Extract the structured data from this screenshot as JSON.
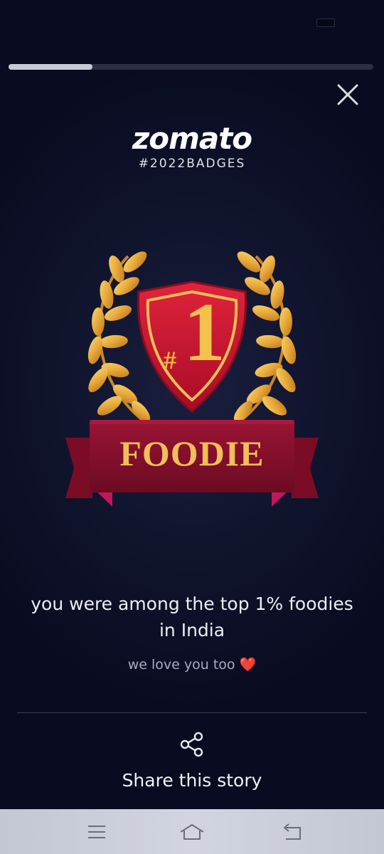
{
  "story": {
    "progress": 0.23,
    "brand": "zomato",
    "tag": "#2022BADGES",
    "badge": {
      "hash": "#",
      "number": "1",
      "ribbon_text": "FOODIE"
    },
    "headline": "you were among the top 1% foodies in India",
    "subline": "we love you too",
    "heart": "❤️",
    "share_label": "Share this story"
  },
  "icons": {
    "close": "close-icon",
    "share": "share-icon",
    "menu": "menu-icon",
    "home": "home-icon",
    "back": "back-icon"
  },
  "colors": {
    "background": "#0f132c",
    "gold": "#f0be5a",
    "ribbon": "#8e1230",
    "shield": "#c8102e"
  }
}
